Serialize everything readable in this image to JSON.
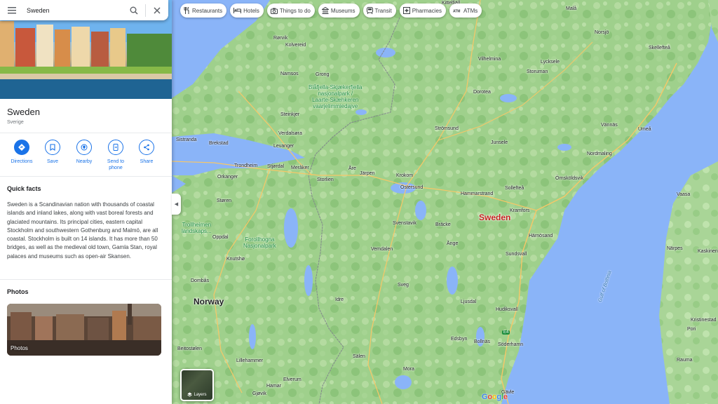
{
  "search": {
    "value": "Sweden"
  },
  "place": {
    "title": "Sweden",
    "subtitle": "Sverige"
  },
  "actions": [
    {
      "label": "Directions",
      "icon": "directions-icon"
    },
    {
      "label": "Save",
      "icon": "bookmark-icon"
    },
    {
      "label": "Nearby",
      "icon": "nearby-icon"
    },
    {
      "label": "Send to\nphone",
      "icon": "send-to-phone-icon"
    },
    {
      "label": "Share",
      "icon": "share-icon"
    }
  ],
  "quick_facts": {
    "title": "Quick facts",
    "text": "Sweden is a Scandinavian nation with thousands of coastal islands and inland lakes, along with vast boreal forests and glaciated mountains. Its principal cities, eastern capital Stockholm and southwestern Gothenburg and Malmö, are all coastal. Stockholm is built on 14 islands. It has more than 50 bridges, as well as the medieval old town, Gamla Stan, royal palaces and museums such as open-air Skansen."
  },
  "photos": {
    "title": "Photos",
    "card_label": "Photos"
  },
  "chips": [
    {
      "label": "Restaurants",
      "icon": "restaurant-icon"
    },
    {
      "label": "Hotels",
      "icon": "hotel-icon"
    },
    {
      "label": "Things to do",
      "icon": "camera-icon"
    },
    {
      "label": "Museums",
      "icon": "museum-icon"
    },
    {
      "label": "Transit",
      "icon": "transit-icon"
    },
    {
      "label": "Pharmacies",
      "icon": "pharmacy-icon"
    },
    {
      "label": "ATMs",
      "icon": "atm-icon"
    }
  ],
  "layers": {
    "label": "Layers"
  },
  "map": {
    "country_label": "Sweden",
    "neighbor_label": "Norway",
    "water_label": "Gulf of Bothnia",
    "parks": [
      "Blåfjella-Skjækerfjella\nnasjonalpark /\nLaarte-Skæhkeren\nvaarjelimmiedajve",
      "Forollhogna\nNasjonalpark",
      "Trollheimen\nlandskaps..."
    ],
    "places": [
      "Kittelfjäll",
      "Malå",
      "Norsjö",
      "Skellefteå",
      "Rørvik",
      "Kolvereid",
      "Vilhelmina",
      "Lycksele",
      "Namsos",
      "Grong",
      "Storuman",
      "Dorotea",
      "Steinkjer",
      "Vännäs",
      "Umeå",
      "Verdalsøra",
      "Strömsund",
      "Levanger",
      "Junsele",
      "Sistranda",
      "Brekstad",
      "Trondheim",
      "Stjørdal",
      "Meråker",
      "Nordmaling",
      "Åre",
      "Järpen",
      "Krokom",
      "Örnsköldsvik",
      "Orkanger",
      "Storlien",
      "Östersund",
      "Hammarstrand",
      "Sollefteå",
      "Vaasa",
      "Støren",
      "Kramfors",
      "Svenstavik",
      "Bräcke",
      "Härnösand",
      "Oppdal",
      "Ånge",
      "Närpes",
      "Kaskinen",
      "Knutshø",
      "Vemdalen",
      "Sundsvall",
      "Dombås",
      "Sveg",
      "Idre",
      "Ljusdal",
      "Hudiksvall",
      "Edsbyn",
      "Bollnäs",
      "Söderhamn",
      "Kristinestad",
      "Sälen",
      "Mora",
      "Beitostølen",
      "Lillehammer",
      "Elverum",
      "Hamar",
      "Gjøvik",
      "Gävle",
      "Pori",
      "Rauma"
    ],
    "road_marker": "E4",
    "attribution": "Google"
  }
}
